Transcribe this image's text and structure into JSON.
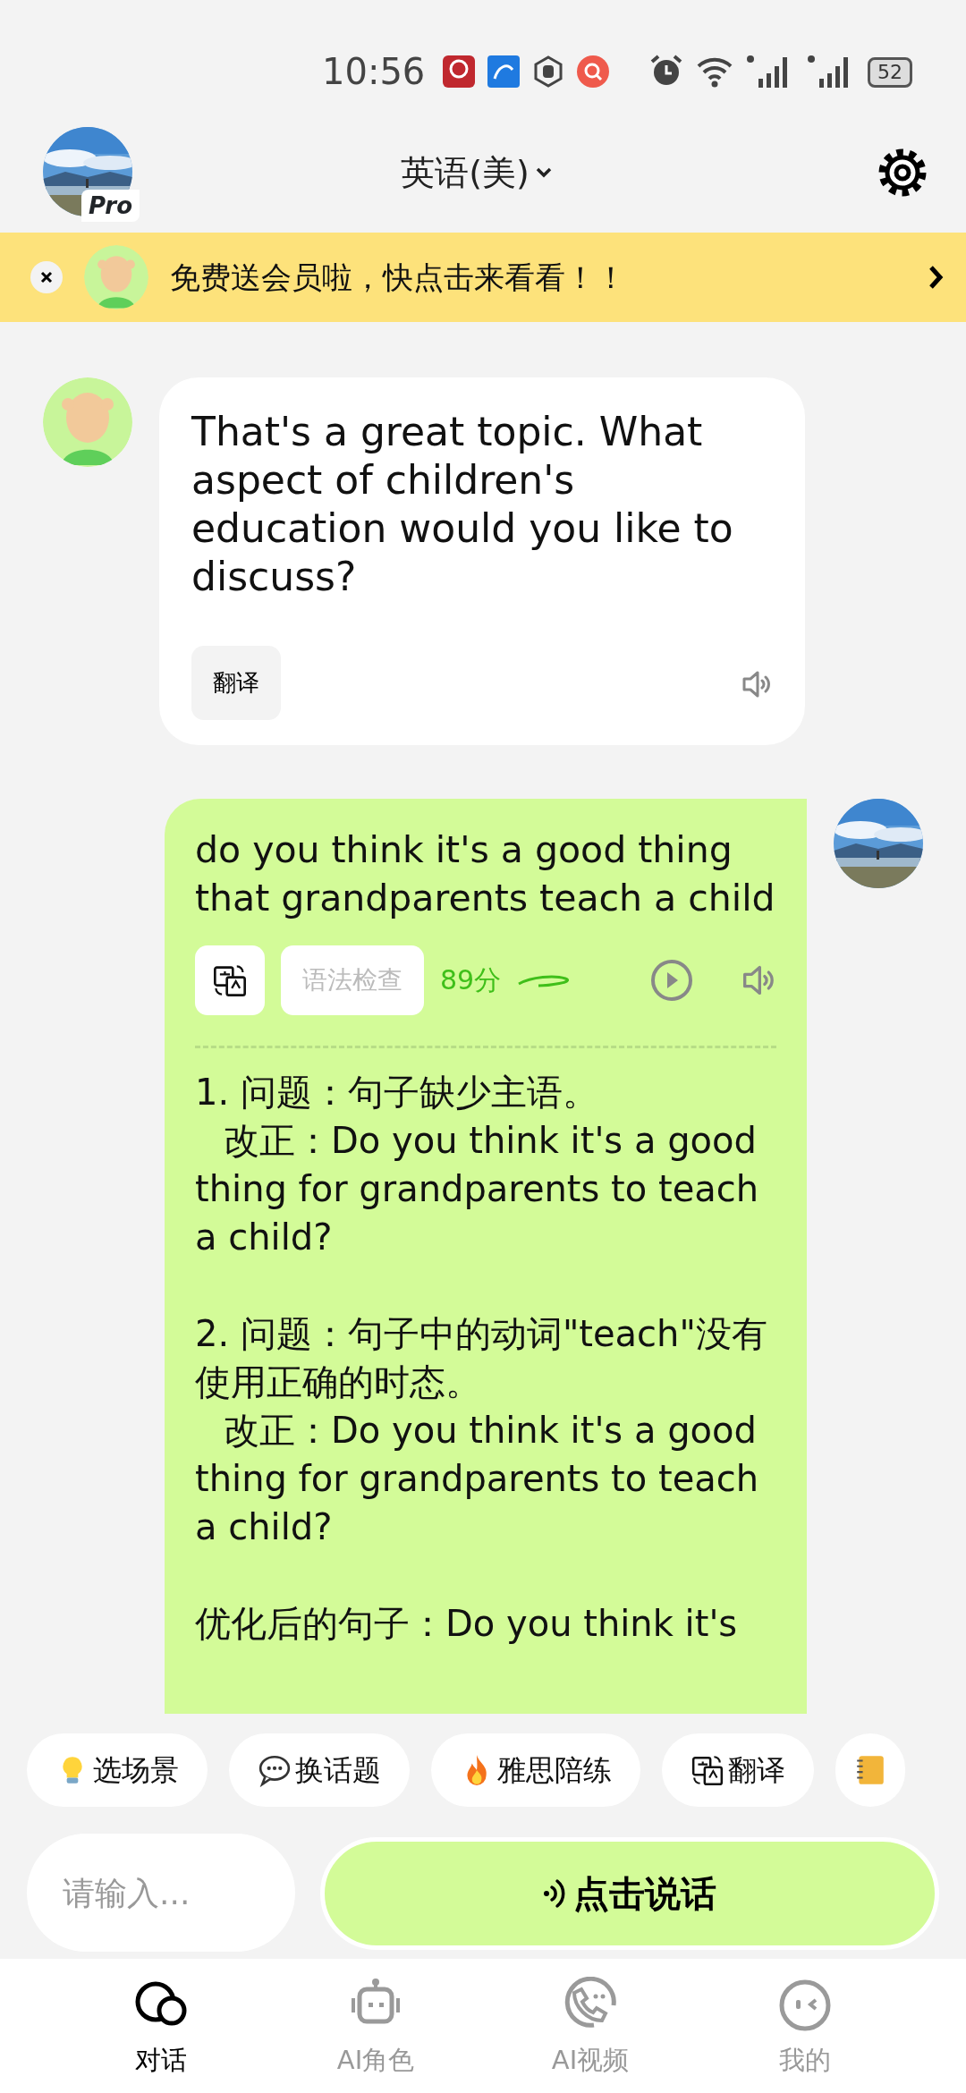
{
  "status_bar": {
    "time": "10:56",
    "battery": "52"
  },
  "header": {
    "title": "英语(美)",
    "badge": "Pro"
  },
  "banner": {
    "text": "免费送会员啦，快点击来看看！！"
  },
  "messages": [
    {
      "kind": "bot",
      "text": "That's a great topic. What aspect of children's education would you like to discuss?",
      "translate_button": "翻译"
    },
    {
      "kind": "user",
      "text": "do you think it's a good thing that grandparents teach a child",
      "grammar_button": {
        "label": "语法检查",
        "disabled": true
      },
      "score": "89分",
      "analysis": [
        {
          "kind": "issue",
          "text": "1. 问题：句子缺少主语。"
        },
        {
          "kind": "fix",
          "text": "改正：Do you think it's a good thing for grandparents to teach a child?"
        },
        {
          "kind": "issue",
          "text": "2. 问题：句子中的动词\"teach\"没有使用正确的时态。"
        },
        {
          "kind": "fix",
          "text": "改正：Do you think it's a good thing for grandparents to teach a child?"
        },
        {
          "kind": "result",
          "text": "优化后的句子：Do you think it's"
        }
      ]
    }
  ],
  "chips": [
    {
      "label": "选场景"
    },
    {
      "label": "换话题"
    },
    {
      "label": "雅思陪练"
    },
    {
      "label": "翻译"
    },
    {
      "kind": "icon_only"
    }
  ],
  "input": {
    "placeholder": "请输入..."
  },
  "speak_button": "点击说话",
  "tabs": [
    {
      "label": "对话",
      "selected": true
    },
    {
      "label": "AI角色",
      "selected": false
    },
    {
      "label": "AI视频",
      "selected": false
    },
    {
      "label": "我的",
      "selected": false
    }
  ]
}
